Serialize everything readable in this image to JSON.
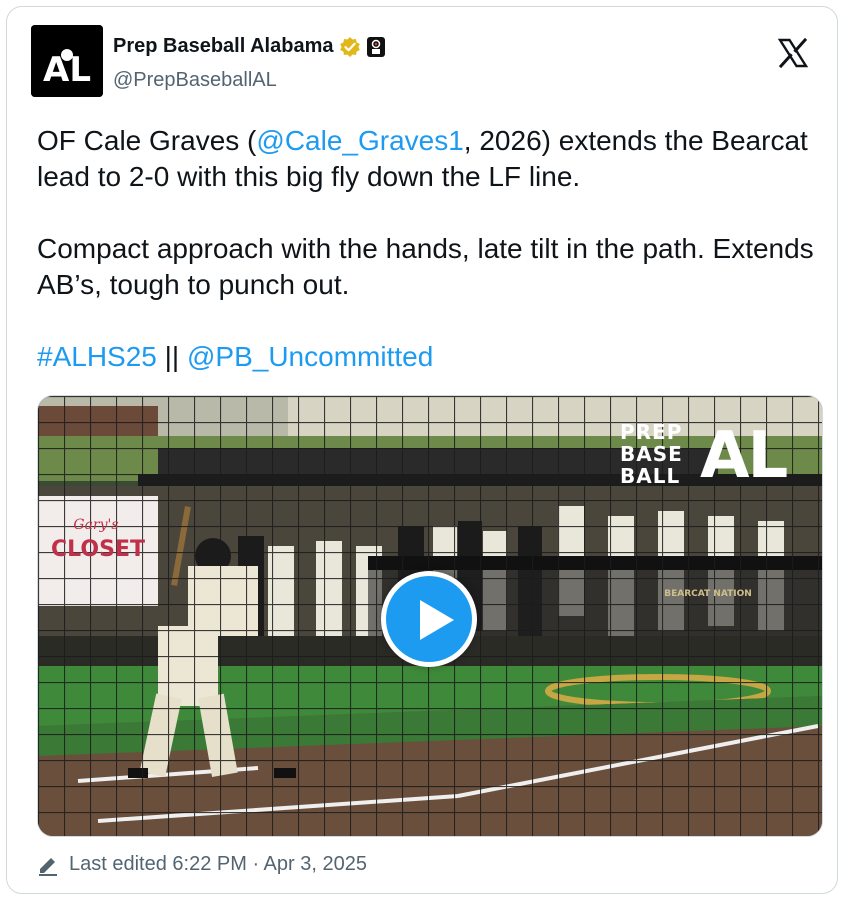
{
  "author": {
    "name": "Prep Baseball Alabama",
    "handle": "@PrepBaseballAL",
    "avatar_text": "AL"
  },
  "tweet": {
    "part1_prefix": "OF Cale Graves (",
    "mention1": "@Cale_Graves1",
    "part1_suffix": ", 2026) extends the Bearcat lead to 2-0 with this big fly down the LF line.",
    "paragraph2": "Compact approach with the hands, late tilt in the path. Extends AB’s, tough to punch out.",
    "hashtag": "#ALHS25",
    "separator": " || ",
    "mention2": "@PB_Uncommitted"
  },
  "media": {
    "watermark_line1": "PREP",
    "watermark_line2": "BASE",
    "watermark_line3": "BALL",
    "watermark_logo": "AL",
    "sign_top": "Gary's",
    "sign_bottom": "CLOSET",
    "dugout_text": "BEARCAT NATION"
  },
  "footer": {
    "edited_text": "Last edited 6:22 PM · Apr 3, 2025"
  },
  "colors": {
    "link": "#1d9bf0",
    "secondary": "#536471",
    "verified_gold": "#e2b719"
  },
  "icons": [
    "verified-badge-icon",
    "affiliate-badge-icon",
    "x-logo-icon",
    "play-icon",
    "pencil-icon"
  ]
}
